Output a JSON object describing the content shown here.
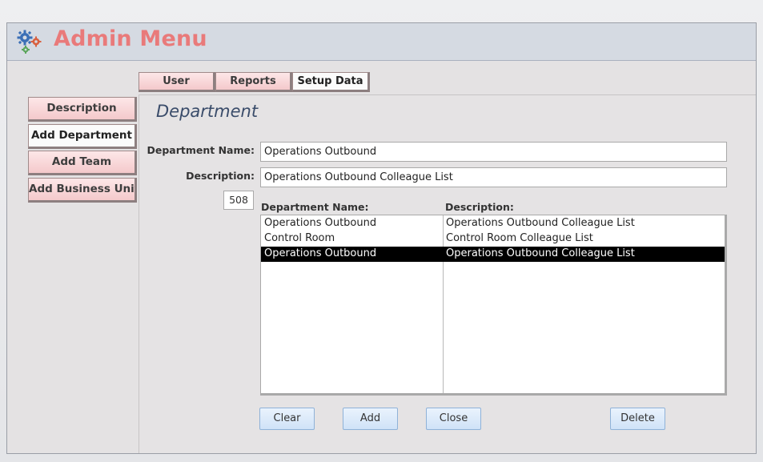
{
  "header": {
    "title": "Admin Menu",
    "icon": "gears-icon"
  },
  "tabs": [
    {
      "label": "User"
    },
    {
      "label": "Reports"
    },
    {
      "label": "Setup Data"
    }
  ],
  "sidebar": {
    "items": [
      {
        "label": "Description"
      },
      {
        "label": "Add Department"
      },
      {
        "label": "Add Team"
      },
      {
        "label": "Add Business Unit"
      }
    ]
  },
  "form": {
    "section_title": "Department",
    "department_name_label": "Department  Name:",
    "department_name_value": "Operations Outbound",
    "description_label": "Description:",
    "description_value": "Operations Outbound Colleague List",
    "record_id": "508"
  },
  "list": {
    "headers": {
      "name": "Department Name:",
      "description": "Description:"
    },
    "rows": [
      {
        "name": "Operations Outbound",
        "description": "Operations Outbound Colleague List"
      },
      {
        "name": "Control Room",
        "description": "Control Room Colleague List"
      },
      {
        "name": "Operations Outbound",
        "description": "Operations Outbound Colleague List"
      }
    ]
  },
  "buttons": {
    "clear": "Clear",
    "add": "Add",
    "close": "Close",
    "delete": "Delete"
  },
  "colors": {
    "title": "#e97a7a",
    "tab_bg": "#f4c9cb",
    "selected_row": "#000000",
    "button_bg": "#cfe2f7"
  }
}
